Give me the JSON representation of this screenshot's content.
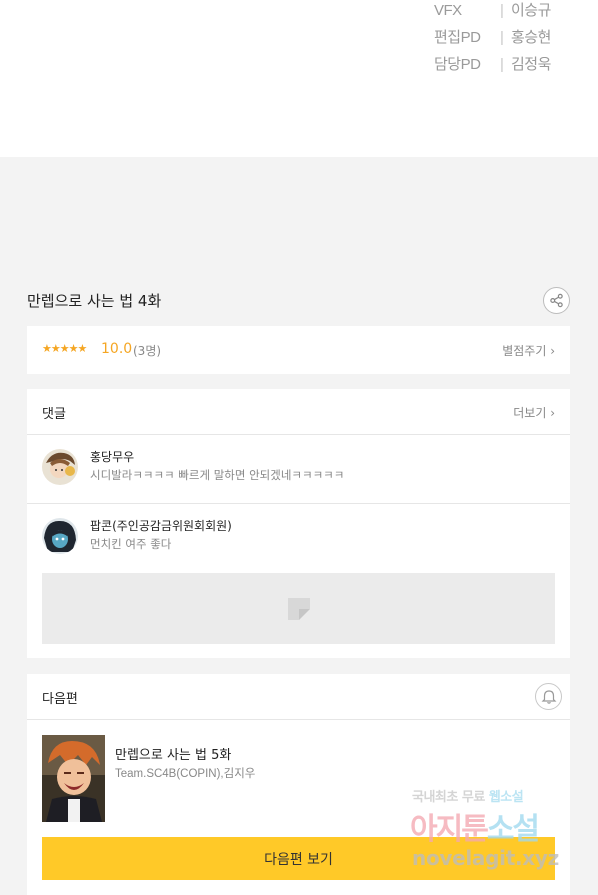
{
  "credits": [
    {
      "role": "VFX",
      "name": "이승규"
    },
    {
      "role": "편집PD",
      "name": "홍승현"
    },
    {
      "role": "담당PD",
      "name": "김정욱"
    }
  ],
  "episode": {
    "title": "만렙으로 사는 법 4화"
  },
  "rating": {
    "stars": "★★★★★",
    "score": "10.0",
    "count": "(3명)",
    "rate_link": "별점주기 ›"
  },
  "comments": {
    "header": "댓글",
    "more": "더보기 ›",
    "items": [
      {
        "name": "홍당무우",
        "text": "시디발라ㅋㅋㅋㅋ 빠르게 말하면 안되겠네ㅋㅋㅋㅋㅋ"
      },
      {
        "name": "팝콘(주인공감금위원회회원)",
        "text": "먼치킨 여주 좋다"
      }
    ]
  },
  "next": {
    "header": "다음편",
    "title": "만렙으로 사는 법 5화",
    "author": "Team.SC4B(COPIN),김지우",
    "button": "다음편 보기"
  },
  "watermark": {
    "line1_a": "국내최초 무료 ",
    "line1_b": "웹소설",
    "line2_a": "아지툰",
    "line2_b": "소설",
    "line3": "novelagit.xyz"
  },
  "icons": [
    "share-icon",
    "bell-icon",
    "ad-placeholder-icon"
  ],
  "colors": {
    "accent": "#ffc928",
    "star": "#f5a623",
    "background": "#f3f3f3"
  }
}
